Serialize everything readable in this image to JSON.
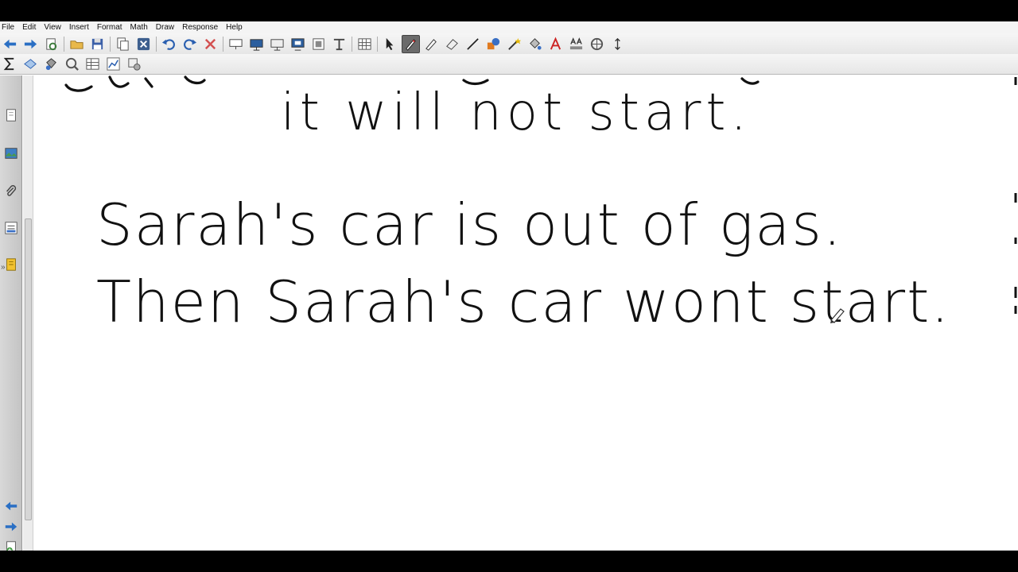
{
  "menu": [
    "File",
    "Edit",
    "View",
    "Insert",
    "Format",
    "Math",
    "Draw",
    "Response",
    "Help"
  ],
  "toolbar1": {
    "tools": [
      "back-icon",
      "forward-icon",
      "refresh-icon",
      "open-folder-icon",
      "save-icon",
      "copy-page-icon",
      "close-page-icon",
      "undo-icon",
      "redo-icon",
      "delete-icon",
      "screen-shade-icon",
      "display-icon",
      "desktop-icon",
      "monitor-icon",
      "capture-icon",
      "pointer-tool-icon",
      "table-icon",
      "select-icon",
      "pen-icon",
      "highlighter-icon",
      "eraser-icon",
      "line-icon",
      "shapes-icon",
      "magic-pen-icon",
      "fill-icon",
      "text-icon",
      "text-format-icon",
      "properties-icon",
      "move-icon"
    ],
    "active_tool": "pen-icon"
  },
  "toolbar2": {
    "tools": [
      "sigma-icon",
      "lasso-icon",
      "paint-bucket-icon",
      "gallery-search-icon",
      "table-insert-icon",
      "graph-icon",
      "stamp-icon"
    ]
  },
  "sidebar": {
    "tools": [
      "page-sorter-icon",
      "gallery-icon",
      "attachments-icon",
      "properties-icon",
      "addons-icon"
    ],
    "expand_label": "»",
    "bottom_tools": [
      "previous-page-icon",
      "next-page-icon",
      "add-page-icon",
      "delete-page-icon"
    ]
  },
  "canvas": {
    "partial_top_line": "it will not start.",
    "line_1": "Sarah's car is out of gas.",
    "line_2": "Then Sarah's car wont start."
  },
  "colors": {
    "ink": "#111111",
    "pen_accent": "#d33"
  }
}
